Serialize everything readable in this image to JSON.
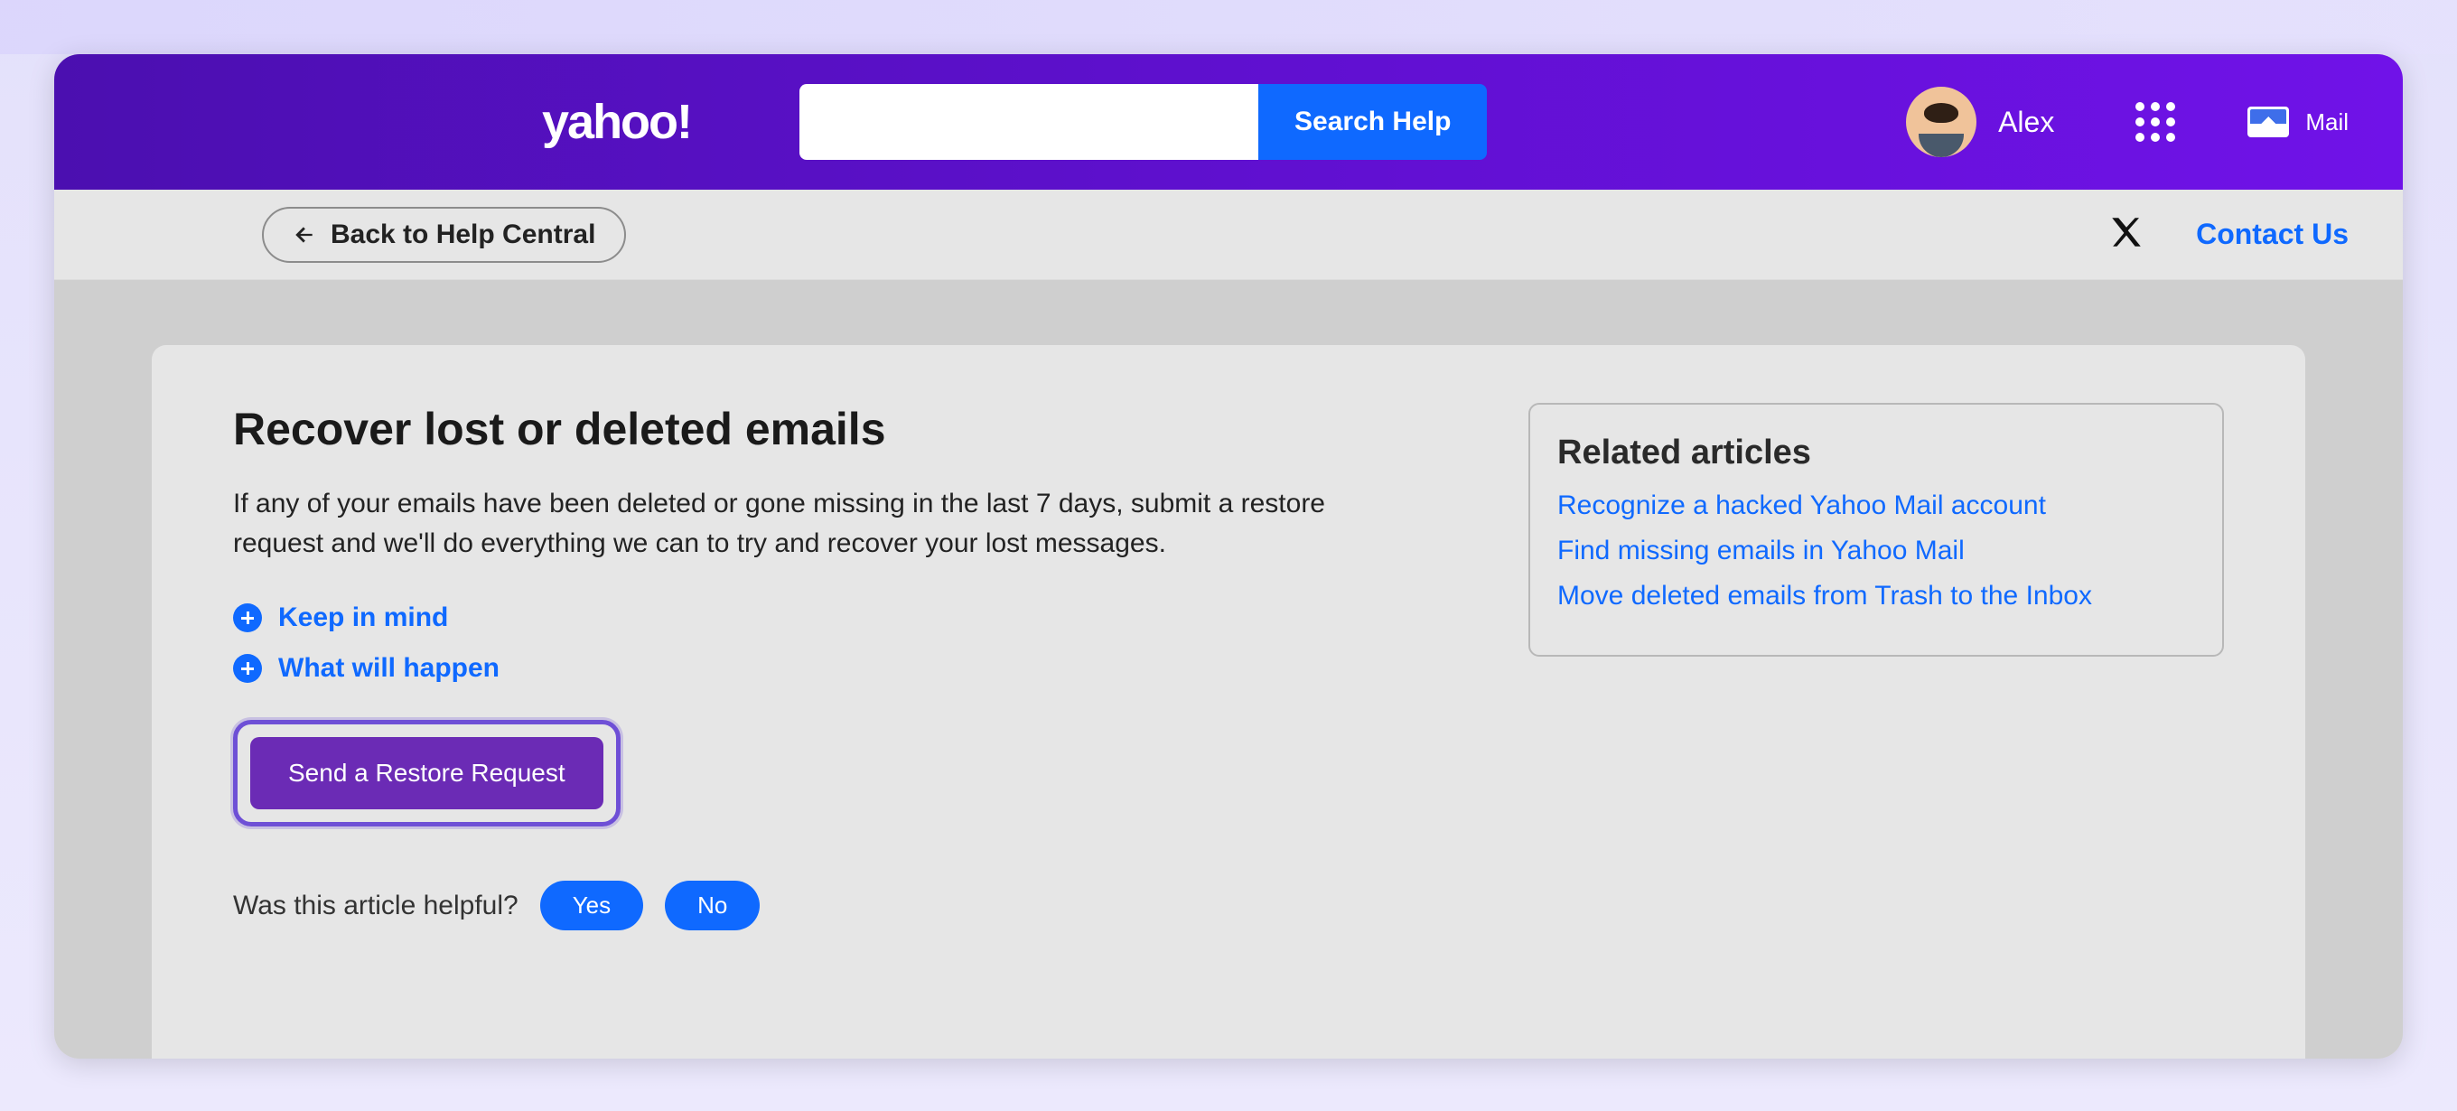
{
  "header": {
    "brand": "yahoo!",
    "search_button": "Search Help",
    "user_name": "Alex",
    "mail_label": "Mail"
  },
  "subbar": {
    "back_label": "Back to Help Central",
    "contact_label": "Contact Us"
  },
  "article": {
    "title": "Recover lost or deleted emails",
    "intro": "If any of your emails have been deleted or gone missing in the last 7 days, submit a restore request and we'll do everything we can to try and recover your lost messages.",
    "accordion": [
      "Keep in mind",
      "What will happen"
    ],
    "cta": "Send a Restore Request",
    "feedback_question": "Was this article helpful?",
    "feedback_yes": "Yes",
    "feedback_no": "No"
  },
  "related": {
    "heading": "Related articles",
    "links": [
      "Recognize a hacked Yahoo Mail account",
      "Find missing emails in Yahoo Mail",
      "Move deleted emails from Trash to the Inbox"
    ]
  }
}
